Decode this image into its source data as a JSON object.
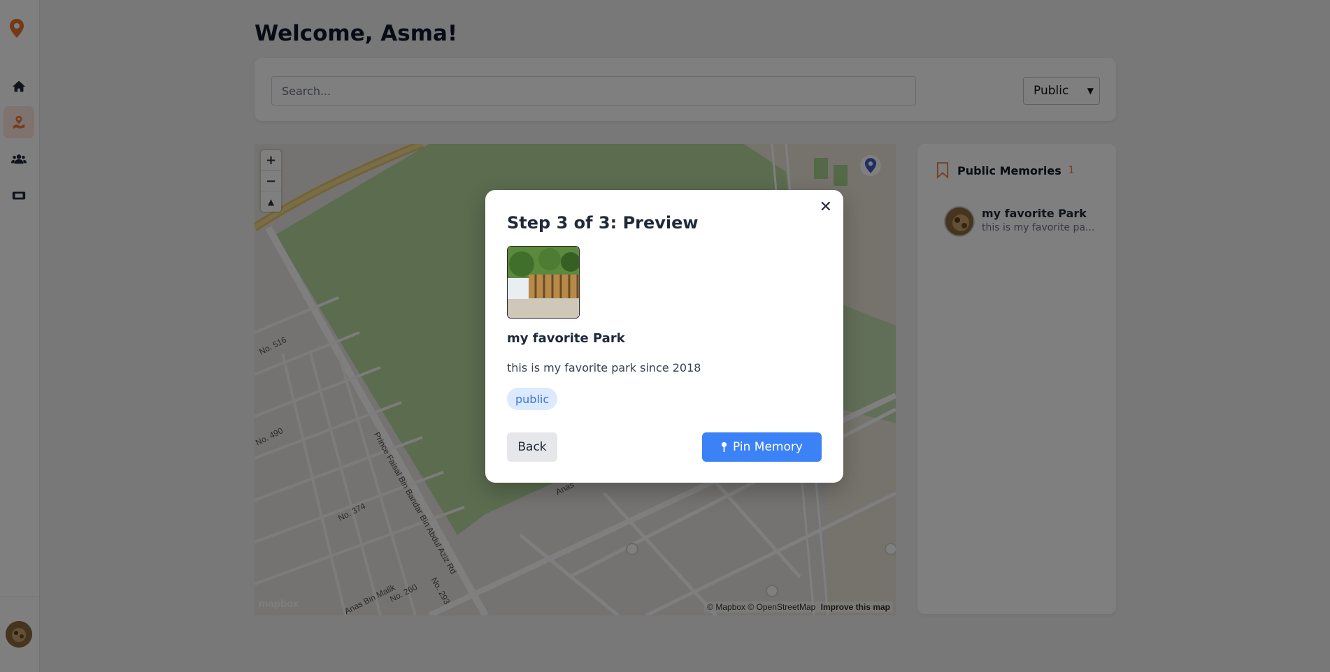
{
  "header": {
    "welcome": "Welcome, Asma!"
  },
  "search": {
    "placeholder": "Search...",
    "visibility_selected": "Public"
  },
  "map": {
    "attribution_mapbox": "© Mapbox",
    "attribution_osm": "© OpenStreetMap",
    "improve_link": "Improve this map",
    "zoom_in": "+",
    "zoom_out": "−",
    "mapbox_logo": "mapbox",
    "streets": [
      "Prince Faisal Bin Bandar Bin Abdul Aziz Rd",
      "Anas Bin Malik",
      "No. 516",
      "No. 490",
      "No. 374",
      "No. 260",
      "No. 293",
      "Anas"
    ]
  },
  "memories_panel": {
    "title": "Public Memories",
    "count": "1",
    "items": [
      {
        "name": "my favorite Park",
        "desc": "this is my favorite pa..."
      }
    ]
  },
  "modal": {
    "close": "✕",
    "title": "Step 3 of 3: Preview",
    "name": "my favorite Park",
    "description": "this is my favorite park since 2018",
    "badge": "public",
    "back_label": "Back",
    "pin_label": "Pin Memory"
  },
  "colors": {
    "accent": "#ea7a3c",
    "primary": "#3b82f6",
    "badge_bg": "#dbeafe"
  }
}
